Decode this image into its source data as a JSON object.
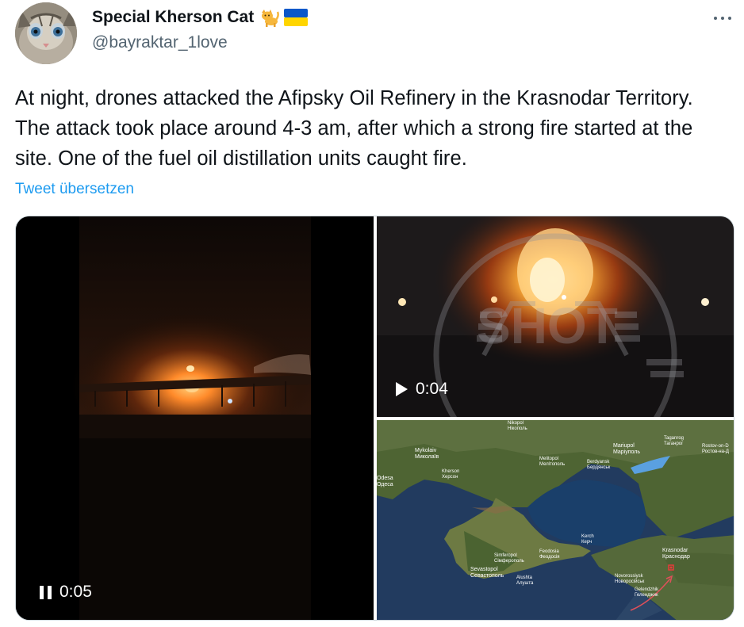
{
  "tweet": {
    "author_name": "Special Kherson Cat",
    "author_emojis": [
      "cat",
      "ukraine-flag"
    ],
    "handle": "@bayraktar_1love",
    "text": "At night, drones attacked the Afipsky Oil Refinery in the Krasnodar Territory. The attack took place around 4-3 am, after which a strong fire started at the site. One of the fuel oil distillation units caught fire.",
    "translate_label": "Tweet übersetzen"
  },
  "media": {
    "video1": {
      "state": "playing",
      "time": "0:05",
      "icon": "pause-icon"
    },
    "video2": {
      "state": "paused",
      "time": "0:04",
      "icon": "play-icon"
    },
    "map": {
      "labels": [
        {
          "en": "Mykolaiv",
          "loc": "Миколаїв"
        },
        {
          "en": "Odesa",
          "loc": "Одеса"
        },
        {
          "en": "Kherson",
          "loc": "Херсон"
        },
        {
          "en": "Nikopol",
          "loc": "Нікополь"
        },
        {
          "en": "Mariupol",
          "loc": "Маріуполь"
        },
        {
          "en": "Taganrog",
          "loc": "Таганрог"
        },
        {
          "en": "Rostov-on-D",
          "loc": "Ростов-на-Д"
        },
        {
          "en": "Melitopol",
          "loc": "Мелітополь"
        },
        {
          "en": "Berdyansk",
          "loc": "Бердянськ"
        },
        {
          "en": "Simferopol",
          "loc": "Сімферополь"
        },
        {
          "en": "Sevastopol",
          "loc": "Севастополь"
        },
        {
          "en": "Kerch",
          "loc": "Керч"
        },
        {
          "en": "Krasnodar",
          "loc": "Краснодар"
        },
        {
          "en": "Novorossiysk",
          "loc": "Новоросійськ"
        },
        {
          "en": "Feodosia",
          "loc": "Феодосія"
        },
        {
          "en": "Alushta",
          "loc": "Алушта"
        },
        {
          "en": "Gelendzhik",
          "loc": "Геленджик"
        }
      ]
    }
  },
  "colors": {
    "link": "#1d9bf0",
    "text": "#0f1419",
    "secondary": "#536471"
  }
}
